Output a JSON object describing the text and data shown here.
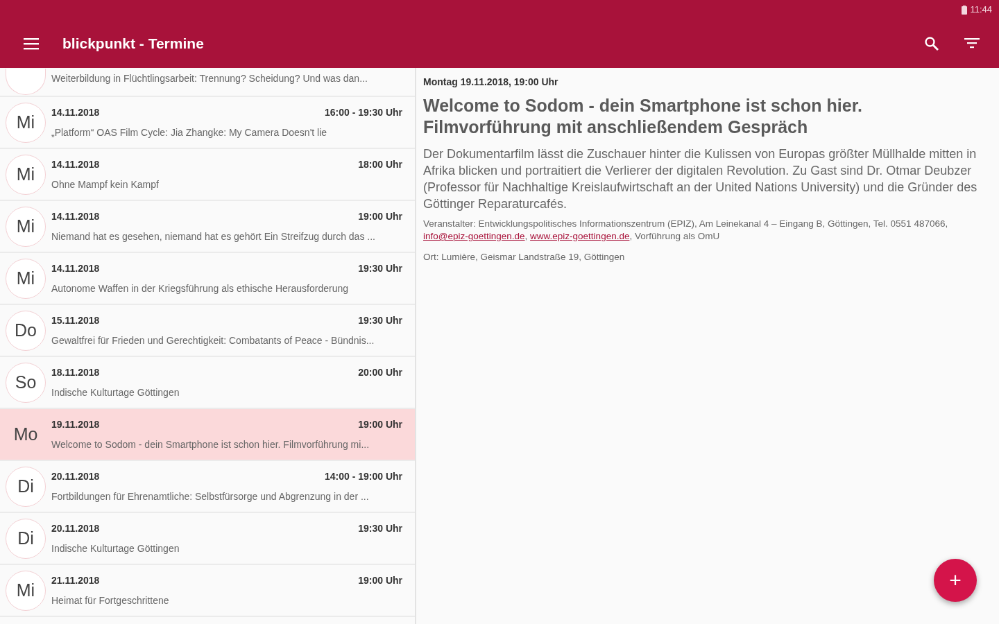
{
  "status_bar": {
    "time": "11:44"
  },
  "toolbar": {
    "title": "blickpunkt - Termine"
  },
  "events": [
    {
      "kind": "partial",
      "title": "Weiterbildung in Flüchtlingsarbeit: Trennung? Scheidung? Und was dan...",
      "selected": false
    },
    {
      "weekday": "Mi",
      "date": "14.11.2018",
      "time": "16:00 - 19:30 Uhr",
      "title": "„Platform“ OAS Film Cycle: Jia Zhangke: My Camera Doesn't lie",
      "selected": false
    },
    {
      "weekday": "Mi",
      "date": "14.11.2018",
      "time": "18:00 Uhr",
      "title": "Ohne Mampf kein Kampf",
      "selected": false
    },
    {
      "weekday": "Mi",
      "date": "14.11.2018",
      "time": "19:00 Uhr",
      "title": "Niemand hat es gesehen, niemand hat es gehört Ein Streifzug durch das ...",
      "selected": false
    },
    {
      "weekday": "Mi",
      "date": "14.11.2018",
      "time": "19:30 Uhr",
      "title": "Autonome Waffen in der Kriegsführung als ethische Herausforderung",
      "selected": false
    },
    {
      "weekday": "Do",
      "date": "15.11.2018",
      "time": "19:30 Uhr",
      "title": "Gewaltfrei für Frieden und Gerechtigkeit: Combatants of Peace - Bündnis...",
      "selected": false
    },
    {
      "weekday": "So",
      "date": "18.11.2018",
      "time": "20:00 Uhr",
      "title": "Indische Kulturtage Göttingen",
      "selected": false
    },
    {
      "weekday": "Mo",
      "date": "19.11.2018",
      "time": "19:00 Uhr",
      "title": "Welcome to Sodom - dein Smartphone ist schon hier. Filmvorführung mi...",
      "selected": true
    },
    {
      "weekday": "Di",
      "date": "20.11.2018",
      "time": "14:00 - 19:00 Uhr",
      "title": "Fortbildungen für Ehrenamtliche: Selbstfürsorge und Abgrenzung in der ...",
      "selected": false
    },
    {
      "weekday": "Di",
      "date": "20.11.2018",
      "time": "19:30 Uhr",
      "title": "Indische Kulturtage Göttingen",
      "selected": false
    },
    {
      "weekday": "Mi",
      "date": "21.11.2018",
      "time": "19:00 Uhr",
      "title": "Heimat für Fortgeschrittene",
      "selected": false
    }
  ],
  "detail": {
    "datetime": "Montag 19.11.2018,  19:00 Uhr",
    "title": "Welcome to Sodom - dein Smartphone ist schon hier. Filmvorführung mit anschließendem Gespräch",
    "description": "Der Dokumentarfilm lässt die Zuschauer hinter die Kulissen von Europas größter Müllhalde mitten in Afrika blicken und portraitiert die Verlierer der digitalen Revolution. Zu Gast sind Dr. Otmar Deubzer (Professor für Nachhaltige Kreislaufwirtschaft an der United Nations University) und die Gründer des Göttinger Reparaturcafés.",
    "organizer": [
      {
        "kind": "text",
        "text": "Veranstalter: Entwicklungspolitisches Informationszentrum (EPIZ), Am Leinekanal 4 – Eingang B, Göttingen, Tel. 0551 487066, "
      },
      {
        "kind": "link",
        "text": "info@epiz-goettingen.de"
      },
      {
        "kind": "text",
        "text": ", "
      },
      {
        "kind": "link",
        "text": "www.epiz-goettingen.de"
      },
      {
        "kind": "text",
        "text": ", Vorführung als OmU"
      }
    ],
    "location": "Ort: Lumière, Geismar Landstraße 19, Göttingen"
  },
  "fab": {
    "label": "+"
  }
}
